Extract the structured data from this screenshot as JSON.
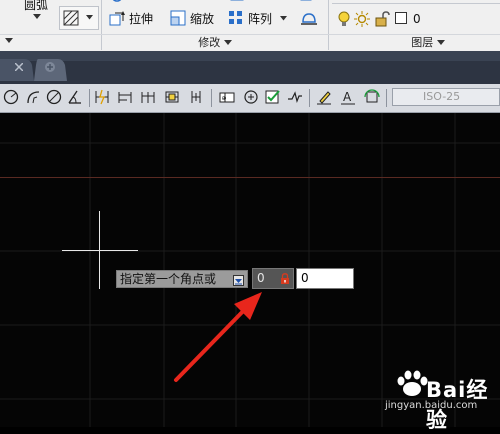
{
  "ribbon": {
    "arc_label": "圆弧",
    "stretch_label": "拉伸",
    "scale_label": "缩放",
    "array_label": "阵列",
    "modify_panel": "修改",
    "layer_panel": "图层",
    "layer_name": "0"
  },
  "toolbar": {
    "dim_style": "ISO-25"
  },
  "dynamic_input": {
    "prompt": "指定第一个角点或",
    "x_value": "0",
    "y_value": "0"
  },
  "watermark": {
    "brand": "Bai经验",
    "url": "jingyan.baidu.com"
  },
  "colors": {
    "canvas": "#050505",
    "ribbon": "#f0f0f0",
    "tabstrip": "#3a4353",
    "arrow": "#e8261c",
    "lock": "#d63b1f"
  }
}
